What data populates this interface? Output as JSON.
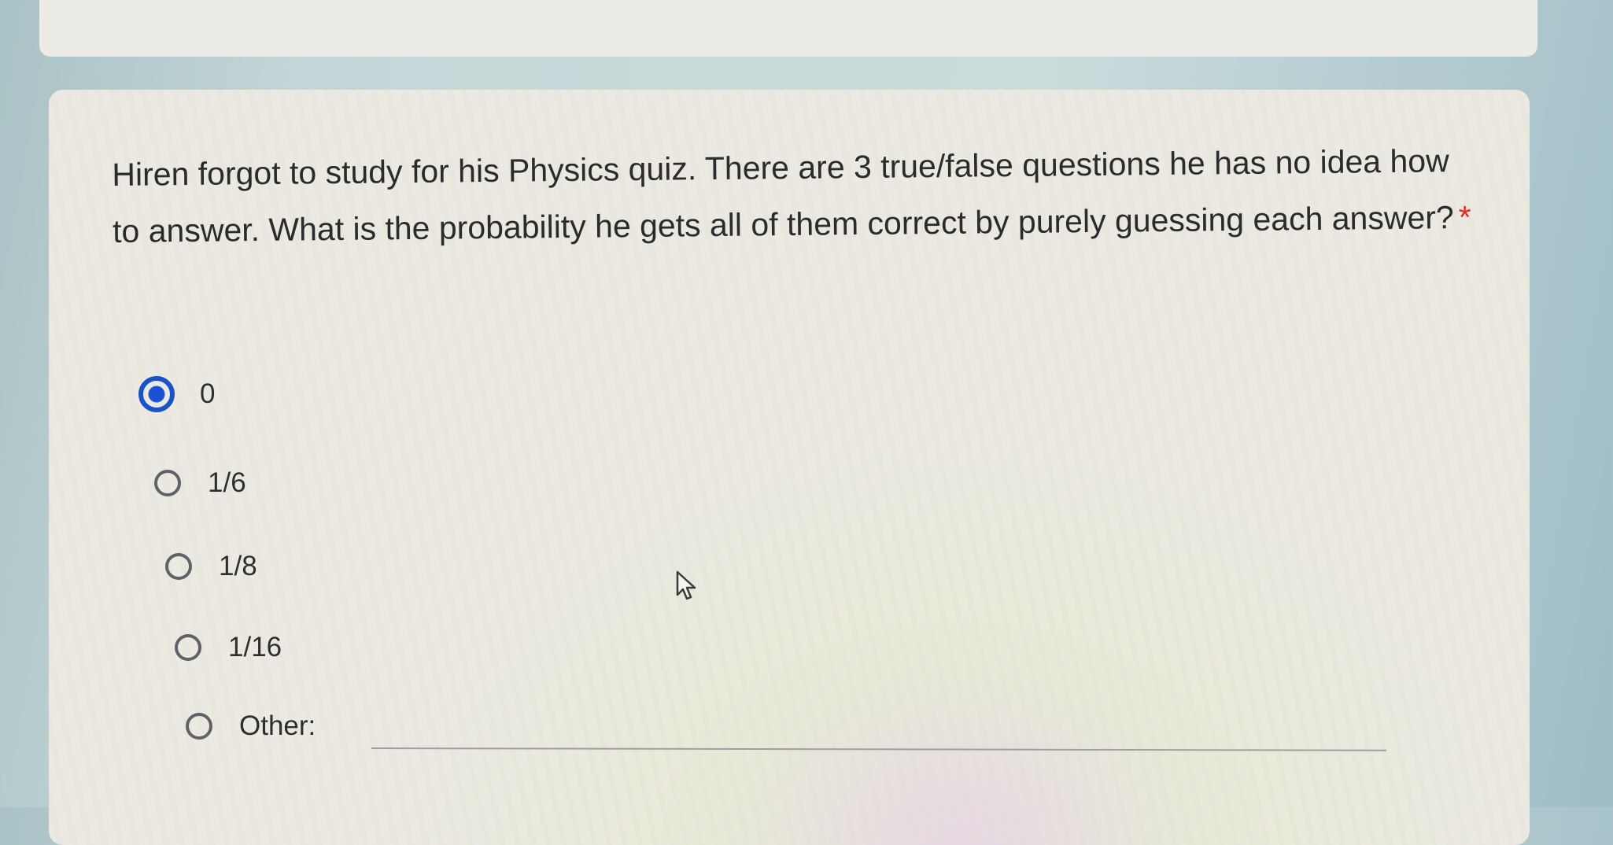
{
  "question": {
    "text": "Hiren forgot to study for his Physics quiz. There are 3 true/false questions he has no idea how to answer. What is the probability he gets all of them correct by purely guessing each answer?",
    "required_marker": "*"
  },
  "options": [
    {
      "label": "0",
      "selected": true
    },
    {
      "label": "1/6",
      "selected": false
    },
    {
      "label": "1/8",
      "selected": false
    },
    {
      "label": "1/16",
      "selected": false
    },
    {
      "label": "Other:",
      "selected": false
    }
  ],
  "colors": {
    "accent": "#1a4fd6",
    "required": "#d93025",
    "radio_unselected": "#5f6368"
  },
  "icons": {
    "cursor": "mouse-pointer-icon"
  }
}
